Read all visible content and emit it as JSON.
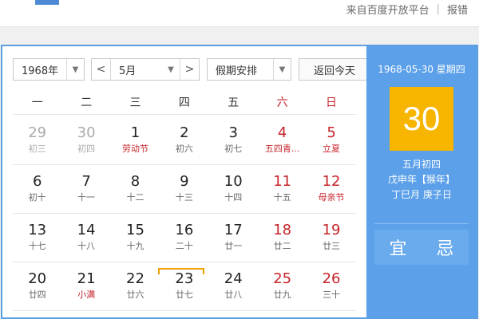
{
  "topbar": {
    "source_text": "来自百度开放平台",
    "report_label": "报错"
  },
  "toolbar": {
    "year_value": "1968年",
    "month_value": "5月",
    "holiday_value": "假期安排",
    "today_label": "返回今天",
    "prev_label": "<",
    "next_label": ">"
  },
  "weekdays": [
    "一",
    "二",
    "三",
    "四",
    "五",
    "六",
    "日"
  ],
  "weeks": [
    [
      {
        "d": "29",
        "l": "初三",
        "other": true
      },
      {
        "d": "30",
        "l": "初四",
        "other": true
      },
      {
        "d": "1",
        "l": "劳动节",
        "fest": true
      },
      {
        "d": "2",
        "l": "初六"
      },
      {
        "d": "3",
        "l": "初七"
      },
      {
        "d": "4",
        "l": "五四青...",
        "fest": true
      },
      {
        "d": "5",
        "l": "立夏",
        "fest": true
      }
    ],
    [
      {
        "d": "6",
        "l": "初十"
      },
      {
        "d": "7",
        "l": "十一"
      },
      {
        "d": "8",
        "l": "十二"
      },
      {
        "d": "9",
        "l": "十三"
      },
      {
        "d": "10",
        "l": "十四"
      },
      {
        "d": "11",
        "l": "十五"
      },
      {
        "d": "12",
        "l": "母亲节",
        "fest": true
      }
    ],
    [
      {
        "d": "13",
        "l": "十七"
      },
      {
        "d": "14",
        "l": "十八"
      },
      {
        "d": "15",
        "l": "十九"
      },
      {
        "d": "16",
        "l": "二十"
      },
      {
        "d": "17",
        "l": "廿一"
      },
      {
        "d": "18",
        "l": "廿二"
      },
      {
        "d": "19",
        "l": "廿三"
      }
    ],
    [
      {
        "d": "20",
        "l": "廿四"
      },
      {
        "d": "21",
        "l": "小满",
        "fest": true
      },
      {
        "d": "22",
        "l": "廿六"
      },
      {
        "d": "23",
        "l": "廿七"
      },
      {
        "d": "24",
        "l": "廿八"
      },
      {
        "d": "25",
        "l": "廿九"
      },
      {
        "d": "26",
        "l": "三十"
      }
    ]
  ],
  "side": {
    "date_line": "1968-05-30 星期四",
    "big_day": "30",
    "lunar_line": "五月初四",
    "ganzhi_year": "戊申年【猴年】",
    "ganzhi_month_day": "丁巳月 庚子日",
    "yi": "宜",
    "ji": "忌"
  },
  "colors": {
    "accent_blue": "#5ba0e9",
    "today_gold": "#f7b500",
    "weekend_red": "#c7242a"
  }
}
